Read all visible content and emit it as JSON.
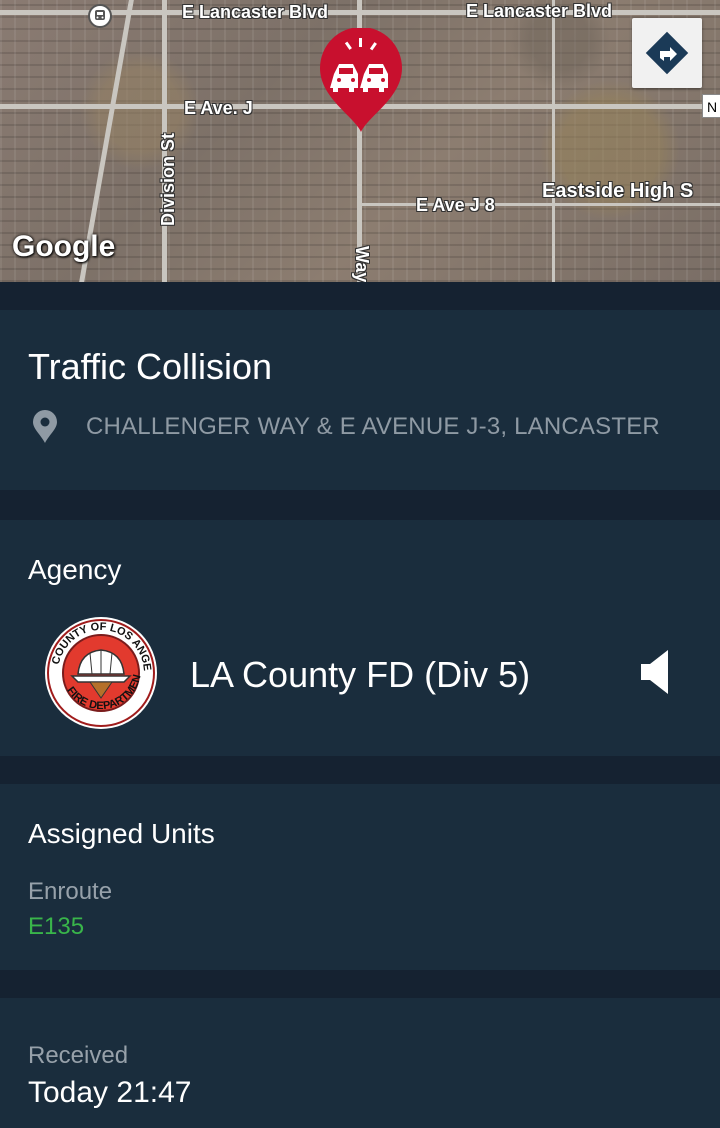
{
  "map": {
    "labels": {
      "lancaster_west": "E Lancaster Blvd",
      "lancaster_east": "E Lancaster Blvd",
      "ave_j": "E Ave. J",
      "division_st": "Division St",
      "ave_j8": "E Ave J 8",
      "eastside_high": "Eastside High S",
      "way": "Way",
      "north_badge": "N"
    },
    "attribution": "Google",
    "pin_icon": "car-collision-icon",
    "directions_icon": "directions-icon",
    "transit_icon": "train-icon"
  },
  "incident": {
    "title": "Traffic Collision",
    "location_icon": "location-pin-icon",
    "address": "CHALLENGER WAY & E AVENUE J-3, LANCASTER"
  },
  "agency": {
    "heading": "Agency",
    "name": "LA County FD (Div 5)",
    "logo_icon": "la-county-fire-department-seal",
    "logo_text": "COUNTY OF LOS ANGELES FIRE DEPARTMENT",
    "speaker_icon": "speaker-icon"
  },
  "units": {
    "heading": "Assigned Units",
    "status_label": "Enroute",
    "unit_id": "E135"
  },
  "received": {
    "label": "Received",
    "value": "Today 21:47"
  },
  "colors": {
    "background": "#152231",
    "card": "#1a2d3d",
    "pin_red": "#c8102e",
    "unit_green": "#39b54a"
  }
}
